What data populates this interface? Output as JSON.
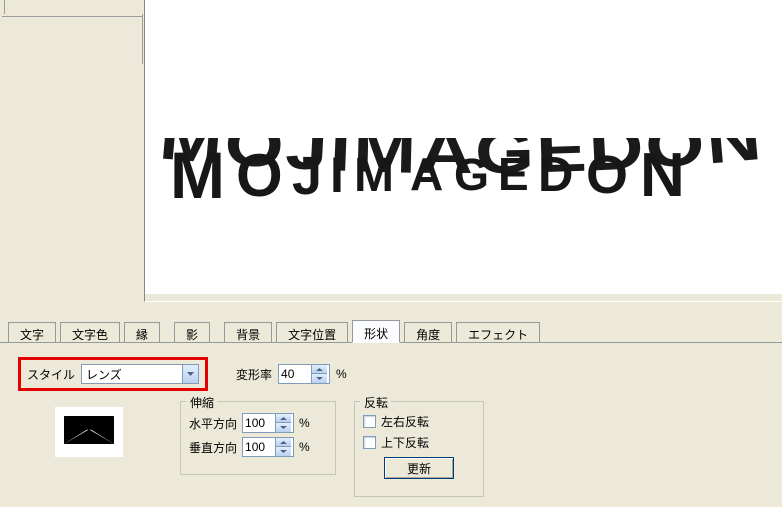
{
  "canvas": {
    "sample_text": "MOJIMAGEDON"
  },
  "tabs": {
    "text": "文字",
    "text_color": "文字色",
    "edge": "縁",
    "shadow": "影",
    "background": "背景",
    "text_position": "文字位置",
    "shape": "形状",
    "angle": "角度",
    "effect": "エフェクト"
  },
  "panel": {
    "style_label": "スタイル",
    "style_value": "レンズ",
    "deform_label": "変形率",
    "deform_value": "40",
    "percent": "%"
  },
  "scale_group": {
    "title": "伸縮",
    "hlabel": "水平方向",
    "hvalue": "100",
    "vlabel": "垂直方向",
    "vvalue": "100",
    "percent": "%"
  },
  "flip_group": {
    "title": "反転",
    "lr": "左右反転",
    "ud": "上下反転",
    "update": "更新"
  }
}
